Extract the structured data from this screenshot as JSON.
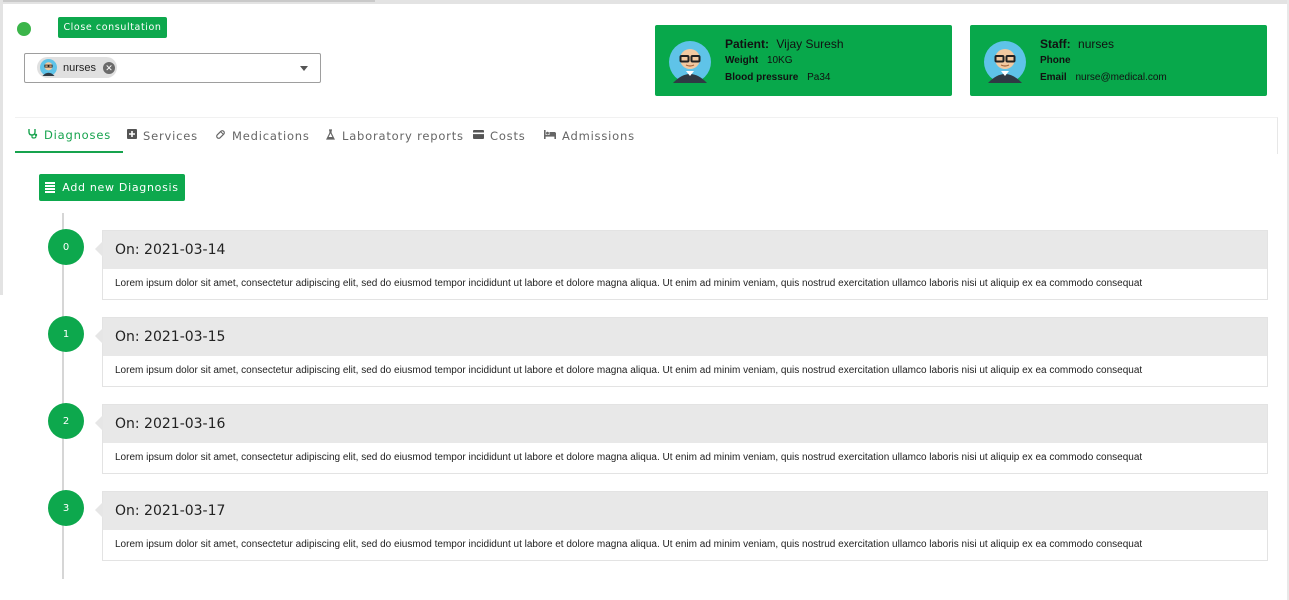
{
  "header": {
    "close_label": "Close consultation",
    "status_color": "#3bb54a",
    "accent_color": "#0da84d"
  },
  "staff_select": {
    "chip_label": "nurses",
    "chip_icon": "avatar-icon",
    "remove_icon": "close-circle-icon",
    "arrow_icon": "chevron-down-icon"
  },
  "patient_card": {
    "title_label": "Patient:",
    "name": "Vijay Suresh",
    "weight_label": "Weight",
    "weight_value": "10KG",
    "bp_label": "Blood pressure",
    "bp_value": "Pa34"
  },
  "staff_card": {
    "title_label": "Staff:",
    "name": "nurses",
    "phone_label": "Phone",
    "phone_value": "",
    "email_label": "Email",
    "email_value": "nurse@medical.com"
  },
  "tabs": [
    {
      "label": "Diagnoses",
      "icon": "stethoscope-icon",
      "active": true
    },
    {
      "label": "Services",
      "icon": "plus-square-icon",
      "active": false
    },
    {
      "label": "Medications",
      "icon": "pill-icon",
      "active": false
    },
    {
      "label": "Laboratory reports",
      "icon": "flask-icon",
      "active": false
    },
    {
      "label": "Costs",
      "icon": "credit-card-icon",
      "active": false
    },
    {
      "label": "Admissions",
      "icon": "bed-icon",
      "active": false
    }
  ],
  "add_button_label": "Add new Diagnosis",
  "diagnoses": [
    {
      "index": "0",
      "date": "On: 2021-03-14",
      "text": "Lorem ipsum dolor sit amet, consectetur adipiscing elit, sed do eiusmod tempor incididunt ut labore et dolore magna aliqua. Ut enim ad minim veniam, quis nostrud exercitation ullamco laboris nisi ut aliquip ex ea commodo consequat"
    },
    {
      "index": "1",
      "date": "On: 2021-03-15",
      "text": "Lorem ipsum dolor sit amet, consectetur adipiscing elit, sed do eiusmod tempor incididunt ut labore et dolore magna aliqua. Ut enim ad minim veniam, quis nostrud exercitation ullamco laboris nisi ut aliquip ex ea commodo consequat"
    },
    {
      "index": "2",
      "date": "On: 2021-03-16",
      "text": "Lorem ipsum dolor sit amet, consectetur adipiscing elit, sed do eiusmod tempor incididunt ut labore et dolore magna aliqua. Ut enim ad minim veniam, quis nostrud exercitation ullamco laboris nisi ut aliquip ex ea commodo consequat"
    },
    {
      "index": "3",
      "date": "On: 2021-03-17",
      "text": "Lorem ipsum dolor sit amet, consectetur adipiscing elit, sed do eiusmod tempor incididunt ut labore et dolore magna aliqua. Ut enim ad minim veniam, quis nostrud exercitation ullamco laboris nisi ut aliquip ex ea commodo consequat"
    }
  ]
}
